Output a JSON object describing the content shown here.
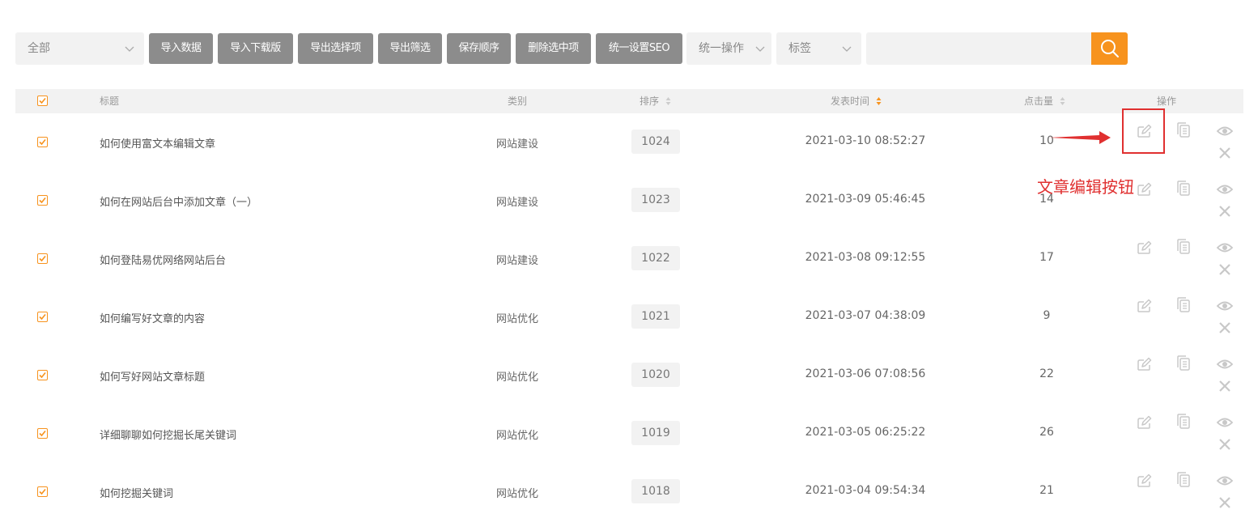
{
  "toolbar": {
    "category_select": "全部",
    "buttons": [
      "导入数据",
      "导入下载版",
      "导出选择项",
      "导出筛选",
      "保存顺序",
      "删除选中项",
      "统一设置SEO"
    ],
    "batch_select": "统一操作",
    "tag_select": "标签",
    "search_placeholder": "",
    "accent_color": "#f7931e"
  },
  "table": {
    "headers": {
      "title": "标题",
      "category": "类别",
      "order": "排序",
      "time": "发表时间",
      "hits": "点击量",
      "actions": "操作"
    },
    "rows": [
      {
        "title": "如何使用富文本编辑文章",
        "category": "网站建设",
        "order": "1024",
        "time": "2021-03-10 08:52:27",
        "hits": "10"
      },
      {
        "title": "如何在网站后台中添加文章（一）",
        "category": "网站建设",
        "order": "1023",
        "time": "2021-03-09 05:46:45",
        "hits": "14"
      },
      {
        "title": "如何登陆易优网络网站后台",
        "category": "网站建设",
        "order": "1022",
        "time": "2021-03-08 09:12:55",
        "hits": "17"
      },
      {
        "title": "如何编写好文章的内容",
        "category": "网站优化",
        "order": "1021",
        "time": "2021-03-07 04:38:09",
        "hits": "9"
      },
      {
        "title": "如何写好网站文章标题",
        "category": "网站优化",
        "order": "1020",
        "time": "2021-03-06 07:08:56",
        "hits": "22"
      },
      {
        "title": "详细聊聊如何挖掘长尾关键词",
        "category": "网站优化",
        "order": "1019",
        "time": "2021-03-05 06:25:22",
        "hits": "26"
      },
      {
        "title": "如何挖掘关键词",
        "category": "网站优化",
        "order": "1018",
        "time": "2021-03-04 09:54:34",
        "hits": "21"
      }
    ],
    "row_icons": [
      "edit-icon",
      "copy-icon",
      "view-icon",
      "delete-icon"
    ]
  },
  "annotation": {
    "label": "文章编辑按钮",
    "color": "#e03030"
  }
}
